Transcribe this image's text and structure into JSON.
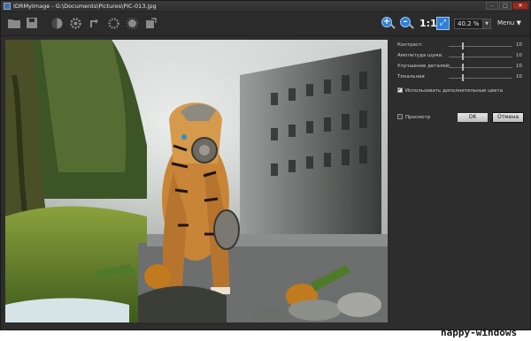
{
  "window": {
    "title": "IDRMyImage - G:\\Documents\\Pictures\\PIC-013.jpg",
    "buttons": {
      "minimize": "–",
      "maximize": "□",
      "close": "✕"
    }
  },
  "toolbar": {
    "icons": [
      "open-folder-icon",
      "save-icon",
      "contrast-icon",
      "gear-icon",
      "rotate-icon",
      "settings-icon",
      "effects-icon",
      "export-icon"
    ],
    "zoom_in": "+",
    "zoom_out": "–",
    "actual_size": "1:1",
    "fit_icon": "⤢",
    "zoom_value": "40.2 %",
    "zoom_arrow": "▼",
    "menu_label": "Menu",
    "menu_arrow": "▼",
    "accent": "#2f7ed8"
  },
  "panel": {
    "params": [
      {
        "label": "Контраст:",
        "value": "10"
      },
      {
        "label": "Амплитуда шума:",
        "value": "10"
      },
      {
        "label": "Улучшение деталей:",
        "value": "10"
      },
      {
        "label": "Тональная",
        "value": "10"
      }
    ],
    "extra_colors": {
      "label": "Использовать дополнительные цвета",
      "checked": true
    },
    "preview": {
      "label": "Просмотр",
      "checked": false
    },
    "ok_label": "OK",
    "cancel_label": "Отмена"
  },
  "watermark": "happy-windows"
}
